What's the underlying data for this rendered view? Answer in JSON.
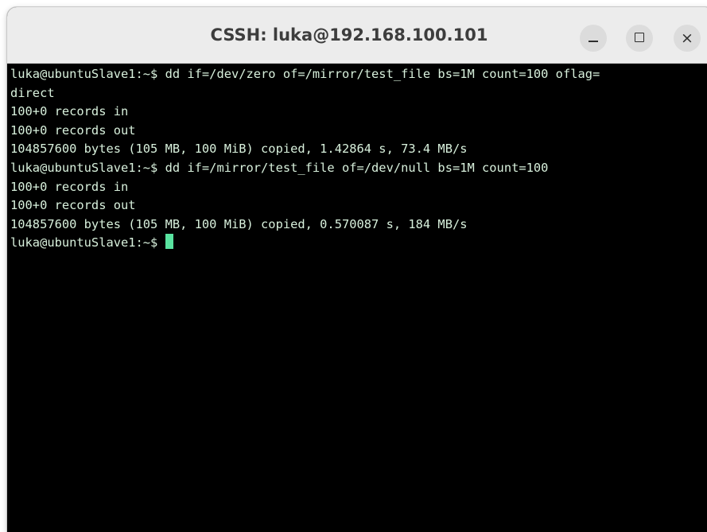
{
  "window": {
    "title": "CSSH: luka@192.168.100.101"
  },
  "controls": {
    "minimize": "minimize-icon",
    "maximize": "maximize-icon",
    "close": "close-icon",
    "close_glyph": "×"
  },
  "terminal": {
    "lines": [
      "luka@ubuntuSlave1:~$ dd if=/dev/zero of=/mirror/test_file bs=1M count=100 oflag=",
      "direct",
      "100+0 records in",
      "100+0 records out",
      "104857600 bytes (105 MB, 100 MiB) copied, 1.42864 s, 73.4 MB/s",
      "luka@ubuntuSlave1:~$ dd if=/mirror/test_file of=/dev/null bs=1M count=100",
      "100+0 records in",
      "100+0 records out",
      "104857600 bytes (105 MB, 100 MiB) copied, 0.570087 s, 184 MB/s"
    ],
    "prompt": "luka@ubuntuSlave1:~$ ",
    "colors": {
      "background": "#000000",
      "foreground": "#d8f0dc",
      "cursor": "#59e3a0"
    }
  }
}
